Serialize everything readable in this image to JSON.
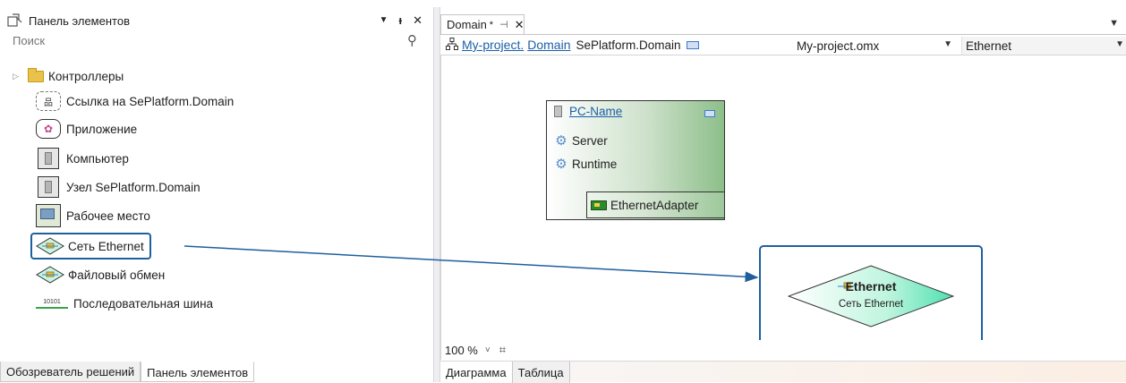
{
  "toolbox": {
    "title": "Панель элементов",
    "pin_glyph": "ᵻ",
    "close_glyph": "✕",
    "dropdown_glyph": "▼",
    "search_placeholder": "Поиск",
    "items": [
      {
        "label": "Контроллеры",
        "icon": "folder-icon",
        "expandable": true
      },
      {
        "label": "Ссылка на SePlatform.Domain",
        "icon": "domain-link-icon"
      },
      {
        "label": "Приложение",
        "icon": "application-icon"
      },
      {
        "label": "Компьютер",
        "icon": "computer-icon"
      },
      {
        "label": "Узел SePlatform.Domain",
        "icon": "domain-node-icon"
      },
      {
        "label": "Рабочее место",
        "icon": "workstation-icon"
      },
      {
        "label": "Сеть Ethernet",
        "icon": "ethernet-network-icon",
        "selected": true
      },
      {
        "label": "Файловый обмен",
        "icon": "file-exchange-icon"
      },
      {
        "label": "Последовательная шина",
        "icon": "serial-bus-icon",
        "icon_text": "10101"
      }
    ],
    "bottom_tabs": [
      {
        "label": "Обозреватель решений",
        "active": false
      },
      {
        "label": "Панель элементов",
        "active": true
      }
    ]
  },
  "document": {
    "tab": {
      "label": "Domain",
      "modified_mark": "*",
      "pin_glyph": "⊣",
      "close_glyph": "✕"
    },
    "breadcrumb": {
      "project_link": "My-project.",
      "domain_link": "Domain",
      "type": "SePlatform.Domain"
    },
    "file_combo": {
      "value": "My-project.omx"
    },
    "network_combo": {
      "value": "Ethernet"
    },
    "diagram": {
      "pc_node": {
        "name": "PC-Name",
        "rows": [
          "Server",
          "Runtime"
        ],
        "adapter": "EthernetAdapter"
      },
      "ethernet_node": {
        "name": "Ethernet",
        "type": "Сеть Ethernet"
      }
    },
    "zoom": {
      "value": "100 %"
    },
    "view_tabs": [
      {
        "label": "Диаграмма",
        "active": true
      },
      {
        "label": "Таблица",
        "active": false
      }
    ]
  },
  "colors": {
    "link": "#1c5fa8",
    "selection_border": "#1f5f9e",
    "node_gradient_end": "#8dbf8a",
    "ethernet_fill": "#4fe0b0"
  }
}
